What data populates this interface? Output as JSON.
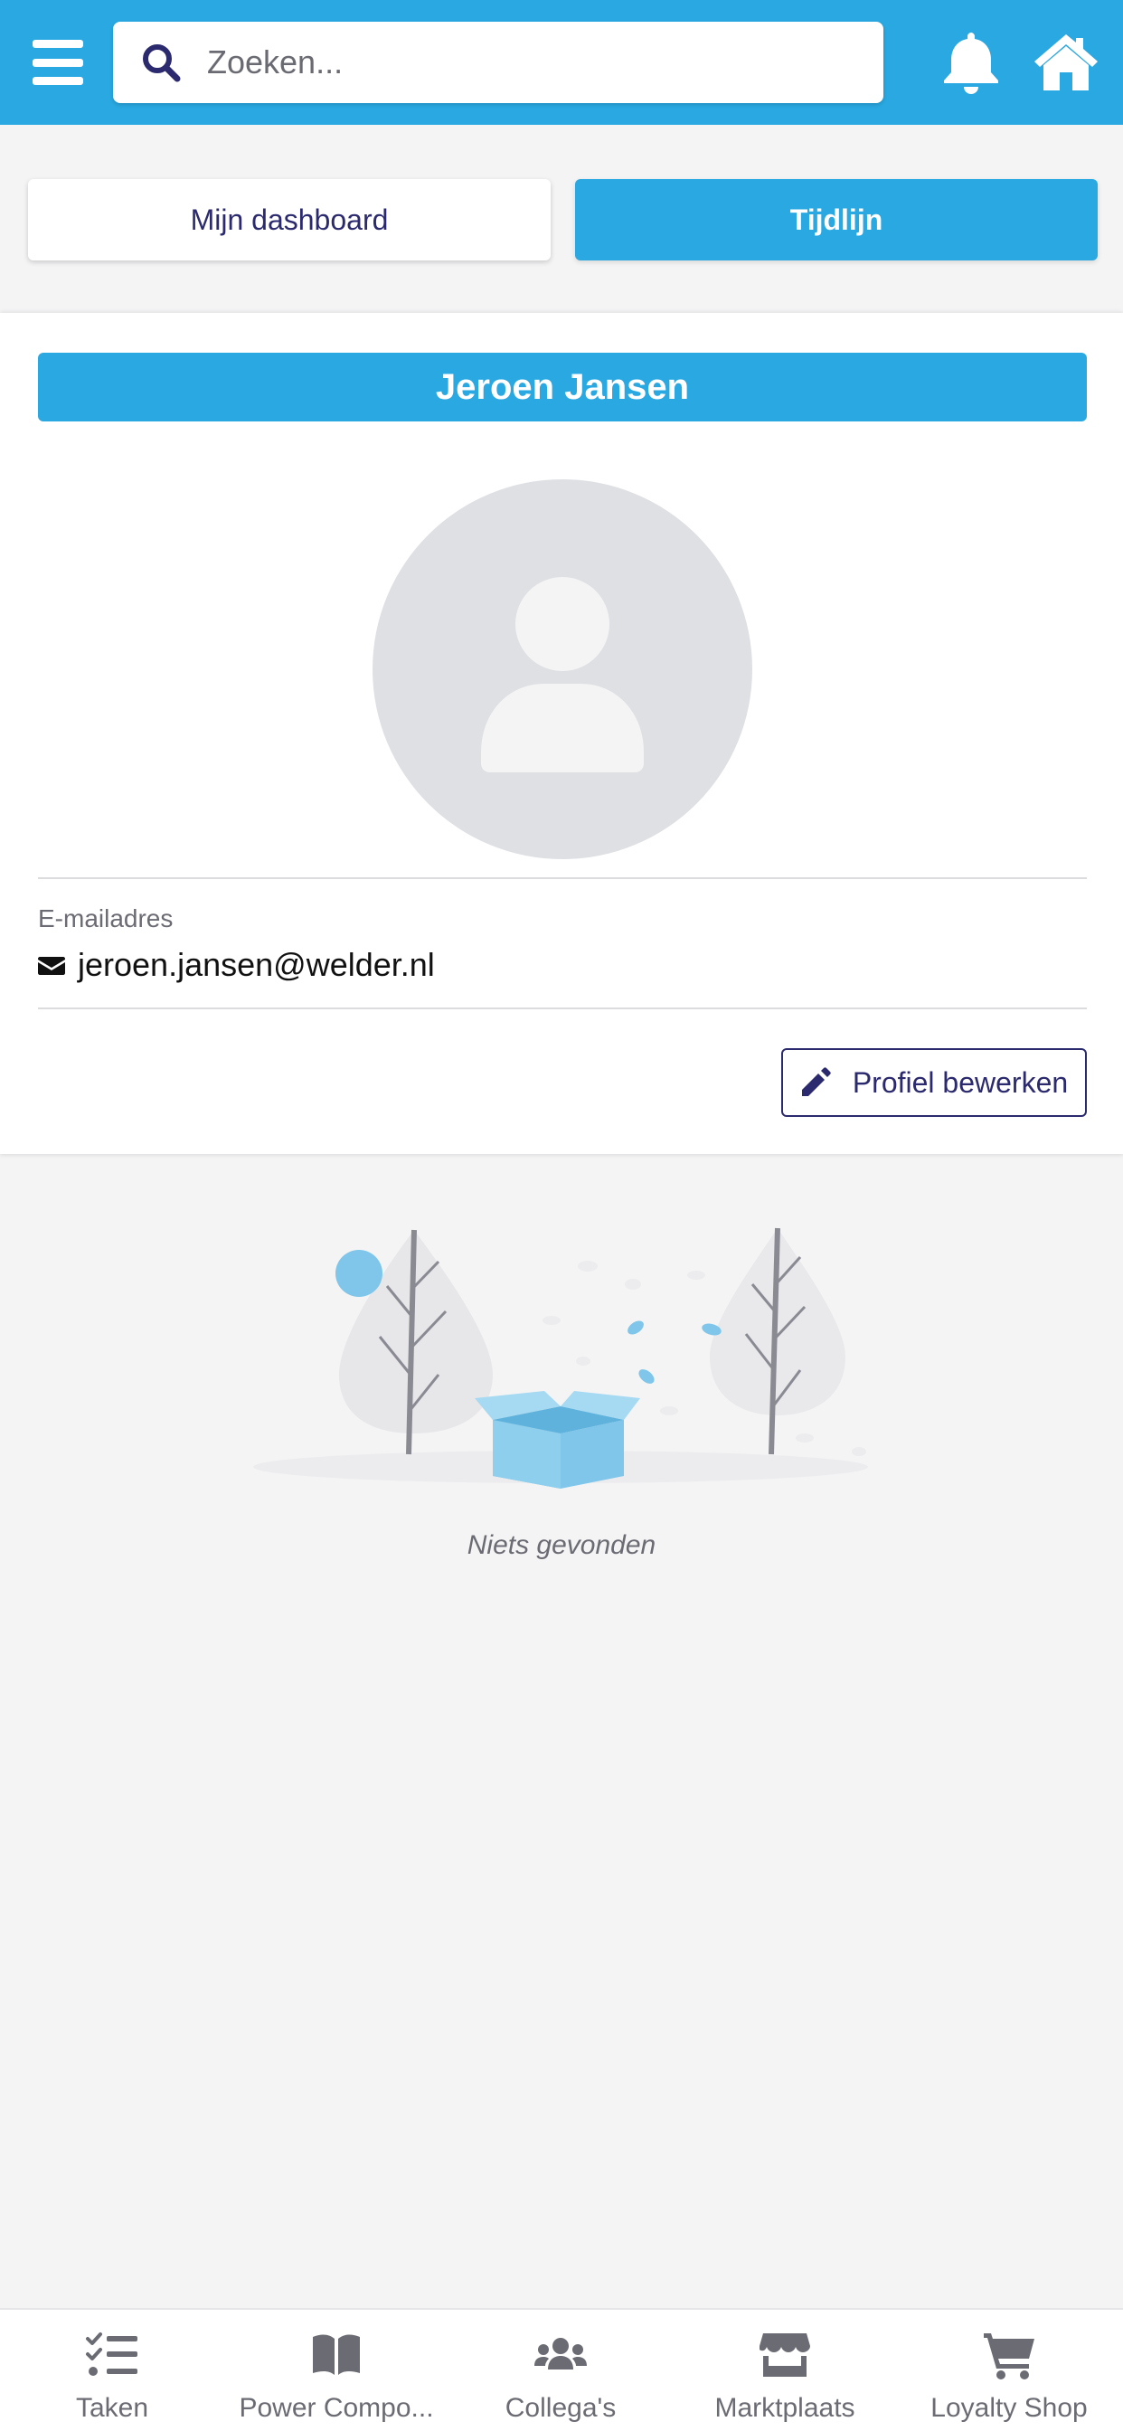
{
  "header": {
    "search_placeholder": "Zoeken...",
    "icons": [
      "menu-icon",
      "search-icon",
      "bell-icon",
      "home-icon"
    ]
  },
  "tabs": {
    "dashboard_label": "Mijn dashboard",
    "timeline_label": "Tijdlijn",
    "active": "Tijdlijn"
  },
  "profile": {
    "name": "Jeroen Jansen",
    "email_label": "E-mailadres",
    "email": "jeroen.jansen@welder.nl",
    "edit_label": "Profiel bewerken"
  },
  "empty_state": {
    "text": "Niets gevonden"
  },
  "bottom_nav": {
    "items": [
      {
        "label": "Taken",
        "icon": "tasks-icon"
      },
      {
        "label": "Power Compo...",
        "icon": "book-icon"
      },
      {
        "label": "Collega's",
        "icon": "users-icon"
      },
      {
        "label": "Marktplaats",
        "icon": "store-icon"
      },
      {
        "label": "Loyalty Shop",
        "icon": "cart-icon"
      }
    ]
  },
  "colors": {
    "primary": "#29a8e1",
    "navy": "#2c2a6e",
    "background": "#f4f4f5",
    "nav_icon": "#6b6b73"
  }
}
